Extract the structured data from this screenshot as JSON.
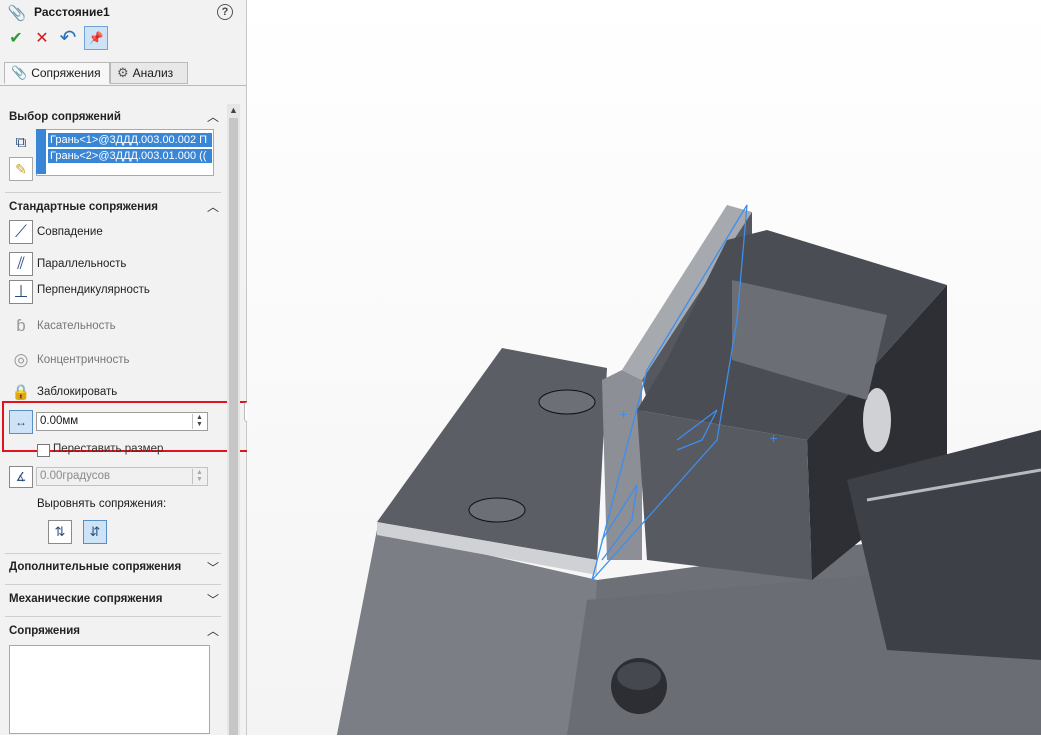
{
  "header": {
    "title": "Расстояние1",
    "help": "?"
  },
  "toolbar": {
    "ok": "✔",
    "cancel": "✕",
    "undo": "↶",
    "pin": "📌"
  },
  "tabs": [
    {
      "label": "Сопряжения",
      "icon": "paperclip-icon",
      "active": true
    },
    {
      "label": "Анализ",
      "icon": "gears-icon",
      "active": false
    }
  ],
  "selection": {
    "title": "Выбор сопряжений",
    "items": [
      "Грань<1>@3ДДД.003.00.002 П",
      "Грань<2>@3ДДД.003.01.000 (("
    ]
  },
  "standard": {
    "title": "Стандартные сопряжения",
    "mates": [
      {
        "label": "Совпадение",
        "icon": "coincident-icon",
        "enabled": true
      },
      {
        "label": "Параллельность",
        "icon": "parallel-icon",
        "enabled": true
      },
      {
        "label": "Перпендикулярность",
        "icon": "perpendicular-icon",
        "enabled": true
      },
      {
        "label": "Касательность",
        "icon": "tangent-icon",
        "enabled": false
      },
      {
        "label": "Концентричность",
        "icon": "concentric-icon",
        "enabled": false
      },
      {
        "label": "Заблокировать",
        "icon": "lock-icon",
        "enabled": true
      }
    ],
    "distance_value": "0.00мм",
    "flip_label": "Переставить размер",
    "angle_value": "0.00градусов",
    "align_label": "Выровнять сопряжения:"
  },
  "sections": {
    "advanced": "Дополнительные сопряжения",
    "mechanical": "Механические сопряжения",
    "mates": "Сопряжения"
  },
  "colors": {
    "accent": "#3a86d6",
    "highlight": "#e0141e",
    "model_body": "#5c5f66",
    "sketch_line": "#3d8ef0"
  }
}
